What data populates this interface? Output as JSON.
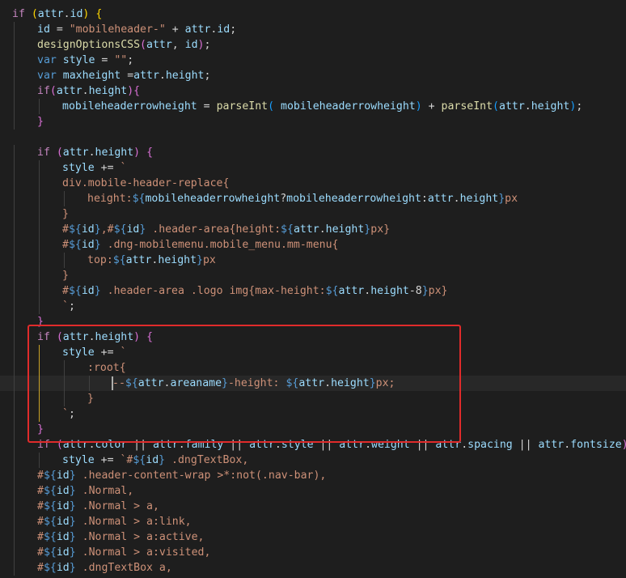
{
  "editor": {
    "language": "javascript",
    "current_line_index": 24,
    "highlight_box_color": "#e02b2b",
    "token_colors": {
      "kw": "#c586c0",
      "st": "#569cd6",
      "fn": "#dcdcaa",
      "vr": "#9cdcfe",
      "tx": "#ce9178",
      "pc": "#d4d4d4",
      "tp": "#569cd6",
      "b1": "#ffd700",
      "b2": "#da70d6",
      "b3": "#179fff"
    },
    "lines": [
      {
        "indent": 0,
        "tokens": [
          [
            "kw",
            "if"
          ],
          [
            "pc",
            " "
          ],
          [
            "b1",
            "("
          ],
          [
            "vr",
            "attr"
          ],
          [
            "pc",
            "."
          ],
          [
            "vr",
            "id"
          ],
          [
            "b1",
            ")"
          ],
          [
            "pc",
            " "
          ],
          [
            "b1",
            "{"
          ]
        ]
      },
      {
        "indent": 1,
        "tokens": [
          [
            "vr",
            "id"
          ],
          [
            "pc",
            " = "
          ],
          [
            "tx",
            "\"mobileheader-\""
          ],
          [
            "pc",
            " + "
          ],
          [
            "vr",
            "attr"
          ],
          [
            "pc",
            "."
          ],
          [
            "vr",
            "id"
          ],
          [
            "pc",
            ";"
          ]
        ]
      },
      {
        "indent": 1,
        "tokens": [
          [
            "fn",
            "designOptionsCSS"
          ],
          [
            "b2",
            "("
          ],
          [
            "vr",
            "attr"
          ],
          [
            "pc",
            ", "
          ],
          [
            "vr",
            "id"
          ],
          [
            "b2",
            ")"
          ],
          [
            "pc",
            ";"
          ]
        ]
      },
      {
        "indent": 1,
        "tokens": [
          [
            "st",
            "var"
          ],
          [
            "pc",
            " "
          ],
          [
            "vr",
            "style"
          ],
          [
            "pc",
            " = "
          ],
          [
            "tx",
            "\"\""
          ],
          [
            "pc",
            ";"
          ]
        ]
      },
      {
        "indent": 1,
        "tokens": [
          [
            "st",
            "var"
          ],
          [
            "pc",
            " "
          ],
          [
            "vr",
            "maxheight"
          ],
          [
            "pc",
            " ="
          ],
          [
            "vr",
            "attr"
          ],
          [
            "pc",
            "."
          ],
          [
            "vr",
            "height"
          ],
          [
            "pc",
            ";"
          ]
        ]
      },
      {
        "indent": 1,
        "tokens": [
          [
            "kw",
            "if"
          ],
          [
            "b2",
            "("
          ],
          [
            "vr",
            "attr"
          ],
          [
            "pc",
            "."
          ],
          [
            "vr",
            "height"
          ],
          [
            "b2",
            ")"
          ],
          [
            "b2",
            "{"
          ]
        ]
      },
      {
        "indent": 2,
        "tokens": [
          [
            "vr",
            "mobileheaderrowheight"
          ],
          [
            "pc",
            " = "
          ],
          [
            "fn",
            "parseInt"
          ],
          [
            "b3",
            "("
          ],
          [
            "pc",
            " "
          ],
          [
            "vr",
            "mobileheaderrowheight"
          ],
          [
            "b3",
            ")"
          ],
          [
            "pc",
            " + "
          ],
          [
            "fn",
            "parseInt"
          ],
          [
            "b3",
            "("
          ],
          [
            "vr",
            "attr"
          ],
          [
            "pc",
            "."
          ],
          [
            "vr",
            "height"
          ],
          [
            "b3",
            ")"
          ],
          [
            "pc",
            ";"
          ]
        ]
      },
      {
        "indent": 1,
        "tokens": [
          [
            "b2",
            "}"
          ]
        ]
      },
      {
        "indent": 0,
        "tokens": []
      },
      {
        "indent": 1,
        "tokens": [
          [
            "kw",
            "if"
          ],
          [
            "pc",
            " "
          ],
          [
            "b2",
            "("
          ],
          [
            "vr",
            "attr"
          ],
          [
            "pc",
            "."
          ],
          [
            "vr",
            "height"
          ],
          [
            "b2",
            ")"
          ],
          [
            "pc",
            " "
          ],
          [
            "b2",
            "{"
          ]
        ]
      },
      {
        "indent": 2,
        "tokens": [
          [
            "vr",
            "style"
          ],
          [
            "pc",
            " += "
          ],
          [
            "tx",
            "`"
          ]
        ]
      },
      {
        "indent": 2,
        "tokens": [
          [
            "tx",
            "div.mobile-header-replace{"
          ]
        ]
      },
      {
        "indent": 3,
        "tokens": [
          [
            "tx",
            "height:"
          ],
          [
            "tp",
            "${"
          ],
          [
            "vr",
            "mobileheaderrowheight"
          ],
          [
            "pc",
            "?"
          ],
          [
            "vr",
            "mobileheaderrowheight"
          ],
          [
            "pc",
            ":"
          ],
          [
            "vr",
            "attr"
          ],
          [
            "pc",
            "."
          ],
          [
            "vr",
            "height"
          ],
          [
            "tp",
            "}"
          ],
          [
            "tx",
            "px"
          ]
        ]
      },
      {
        "indent": 2,
        "tokens": [
          [
            "tx",
            "}"
          ]
        ]
      },
      {
        "indent": 2,
        "tokens": [
          [
            "tx",
            "#"
          ],
          [
            "tp",
            "${"
          ],
          [
            "vr",
            "id"
          ],
          [
            "tp",
            "}"
          ],
          [
            "tx",
            ",#"
          ],
          [
            "tp",
            "${"
          ],
          [
            "vr",
            "id"
          ],
          [
            "tp",
            "}"
          ],
          [
            "tx",
            " .header-area{height:"
          ],
          [
            "tp",
            "${"
          ],
          [
            "vr",
            "attr"
          ],
          [
            "pc",
            "."
          ],
          [
            "vr",
            "height"
          ],
          [
            "tp",
            "}"
          ],
          [
            "tx",
            "px}"
          ]
        ]
      },
      {
        "indent": 2,
        "tokens": [
          [
            "tx",
            "#"
          ],
          [
            "tp",
            "${"
          ],
          [
            "vr",
            "id"
          ],
          [
            "tp",
            "}"
          ],
          [
            "tx",
            " .dng-mobilemenu.mobile_menu.mm-menu{"
          ]
        ]
      },
      {
        "indent": 3,
        "tokens": [
          [
            "tx",
            "top:"
          ],
          [
            "tp",
            "${"
          ],
          [
            "vr",
            "attr"
          ],
          [
            "pc",
            "."
          ],
          [
            "vr",
            "height"
          ],
          [
            "tp",
            "}"
          ],
          [
            "tx",
            "px"
          ]
        ]
      },
      {
        "indent": 2,
        "tokens": [
          [
            "tx",
            "}"
          ]
        ]
      },
      {
        "indent": 2,
        "tokens": [
          [
            "tx",
            "#"
          ],
          [
            "tp",
            "${"
          ],
          [
            "vr",
            "id"
          ],
          [
            "tp",
            "}"
          ],
          [
            "tx",
            " .header-area .logo img{max-height:"
          ],
          [
            "tp",
            "${"
          ],
          [
            "vr",
            "attr"
          ],
          [
            "pc",
            "."
          ],
          [
            "vr",
            "height"
          ],
          [
            "pc",
            "-8"
          ],
          [
            "tp",
            "}"
          ],
          [
            "tx",
            "px}"
          ]
        ]
      },
      {
        "indent": 2,
        "tokens": [
          [
            "tx",
            "`"
          ],
          [
            "pc",
            ";"
          ]
        ]
      },
      {
        "indent": 1,
        "tokens": [
          [
            "b2",
            "}"
          ]
        ]
      },
      {
        "indent": 1,
        "tokens": [
          [
            "kw",
            "if"
          ],
          [
            "pc",
            " "
          ],
          [
            "b2",
            "("
          ],
          [
            "vr",
            "attr"
          ],
          [
            "pc",
            "."
          ],
          [
            "vr",
            "height"
          ],
          [
            "b2",
            ")"
          ],
          [
            "pc",
            " "
          ],
          [
            "b2",
            "{"
          ]
        ]
      },
      {
        "indent": 2,
        "tokens": [
          [
            "vr",
            "style"
          ],
          [
            "pc",
            " += "
          ],
          [
            "tx",
            "`"
          ]
        ]
      },
      {
        "indent": 3,
        "tokens": [
          [
            "tx",
            ":root{"
          ]
        ]
      },
      {
        "indent": 4,
        "tokens": [
          [
            "tx",
            "--"
          ],
          [
            "tp",
            "${"
          ],
          [
            "vr",
            "attr"
          ],
          [
            "pc",
            "."
          ],
          [
            "vr",
            "areaname"
          ],
          [
            "tp",
            "}"
          ],
          [
            "tx",
            "-height: "
          ],
          [
            "tp",
            "${"
          ],
          [
            "vr",
            "attr"
          ],
          [
            "pc",
            "."
          ],
          [
            "vr",
            "height"
          ],
          [
            "tp",
            "}"
          ],
          [
            "tx",
            "px;"
          ]
        ]
      },
      {
        "indent": 3,
        "tokens": [
          [
            "tx",
            "}"
          ]
        ]
      },
      {
        "indent": 2,
        "tokens": [
          [
            "tx",
            "`"
          ],
          [
            "pc",
            ";"
          ]
        ]
      },
      {
        "indent": 1,
        "tokens": [
          [
            "b2",
            "}"
          ]
        ]
      },
      {
        "indent": 1,
        "tokens": [
          [
            "kw",
            "if"
          ],
          [
            "pc",
            " "
          ],
          [
            "b2",
            "("
          ],
          [
            "vr",
            "attr"
          ],
          [
            "pc",
            "."
          ],
          [
            "vr",
            "color"
          ],
          [
            "pc",
            " || "
          ],
          [
            "vr",
            "attr"
          ],
          [
            "pc",
            "."
          ],
          [
            "vr",
            "family"
          ],
          [
            "pc",
            " || "
          ],
          [
            "vr",
            "attr"
          ],
          [
            "pc",
            "."
          ],
          [
            "vr",
            "style"
          ],
          [
            "pc",
            " || "
          ],
          [
            "vr",
            "attr"
          ],
          [
            "pc",
            "."
          ],
          [
            "vr",
            "weight"
          ],
          [
            "pc",
            " || "
          ],
          [
            "vr",
            "attr"
          ],
          [
            "pc",
            "."
          ],
          [
            "vr",
            "spacing"
          ],
          [
            "pc",
            " || "
          ],
          [
            "vr",
            "attr"
          ],
          [
            "pc",
            "."
          ],
          [
            "vr",
            "fontsize"
          ],
          [
            "b2",
            ")"
          ],
          [
            "pc",
            " "
          ],
          [
            "b2",
            "{"
          ]
        ]
      },
      {
        "indent": 2,
        "tokens": [
          [
            "vr",
            "style"
          ],
          [
            "pc",
            " += "
          ],
          [
            "tx",
            "`#"
          ],
          [
            "tp",
            "${"
          ],
          [
            "vr",
            "id"
          ],
          [
            "tp",
            "}"
          ],
          [
            "tx",
            " .dngTextBox,"
          ]
        ]
      },
      {
        "indent": 1,
        "tokens": [
          [
            "tx",
            "#"
          ],
          [
            "tp",
            "${"
          ],
          [
            "vr",
            "id"
          ],
          [
            "tp",
            "}"
          ],
          [
            "tx",
            " .header-content-wrap >*:not(.nav-bar),"
          ]
        ]
      },
      {
        "indent": 1,
        "tokens": [
          [
            "tx",
            "#"
          ],
          [
            "tp",
            "${"
          ],
          [
            "vr",
            "id"
          ],
          [
            "tp",
            "}"
          ],
          [
            "tx",
            " .Normal,"
          ]
        ]
      },
      {
        "indent": 1,
        "tokens": [
          [
            "tx",
            "#"
          ],
          [
            "tp",
            "${"
          ],
          [
            "vr",
            "id"
          ],
          [
            "tp",
            "}"
          ],
          [
            "tx",
            " .Normal > a,"
          ]
        ]
      },
      {
        "indent": 1,
        "tokens": [
          [
            "tx",
            "#"
          ],
          [
            "tp",
            "${"
          ],
          [
            "vr",
            "id"
          ],
          [
            "tp",
            "}"
          ],
          [
            "tx",
            " .Normal > a:link,"
          ]
        ]
      },
      {
        "indent": 1,
        "tokens": [
          [
            "tx",
            "#"
          ],
          [
            "tp",
            "${"
          ],
          [
            "vr",
            "id"
          ],
          [
            "tp",
            "}"
          ],
          [
            "tx",
            " .Normal > a:active,"
          ]
        ]
      },
      {
        "indent": 1,
        "tokens": [
          [
            "tx",
            "#"
          ],
          [
            "tp",
            "${"
          ],
          [
            "vr",
            "id"
          ],
          [
            "tp",
            "}"
          ],
          [
            "tx",
            " .Normal > a:visited,"
          ]
        ]
      },
      {
        "indent": 1,
        "tokens": [
          [
            "tx",
            "#"
          ],
          [
            "tp",
            "${"
          ],
          [
            "vr",
            "id"
          ],
          [
            "tp",
            "}"
          ],
          [
            "tx",
            " .dngTextBox a,"
          ]
        ]
      }
    ]
  }
}
